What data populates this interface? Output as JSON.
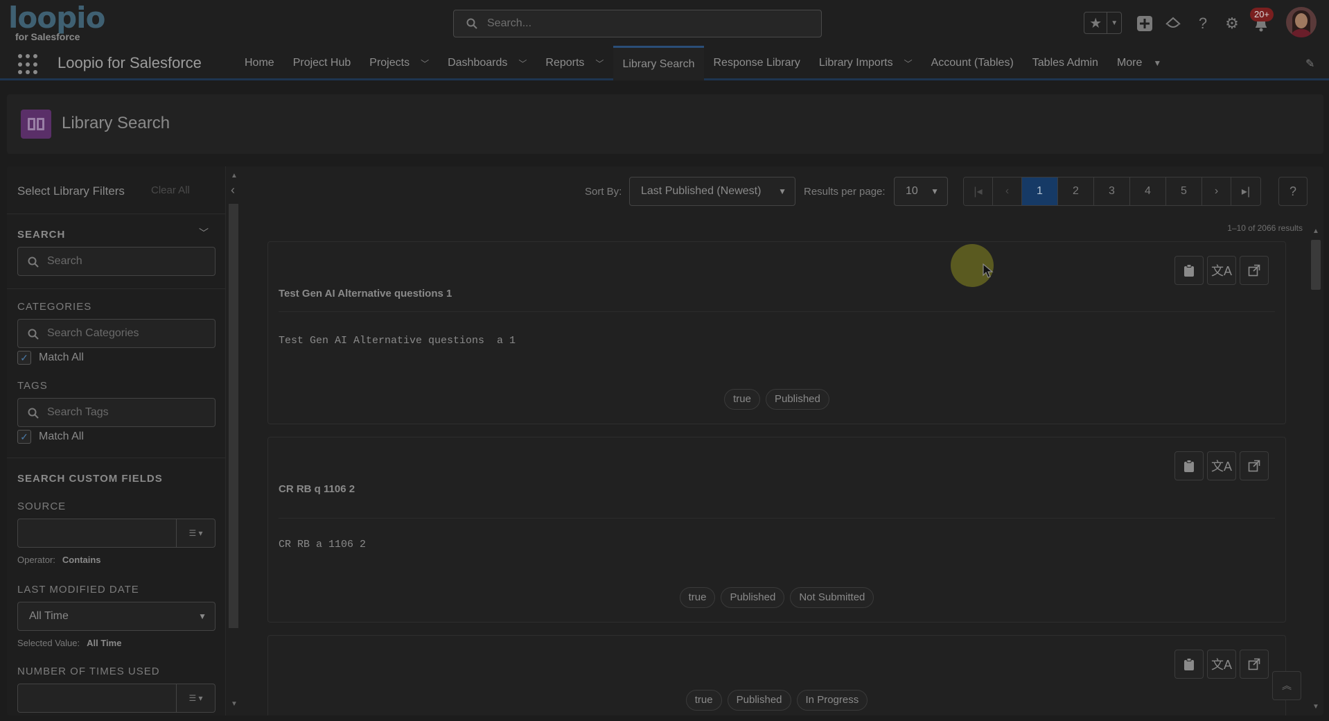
{
  "brand": {
    "logo_text": "loopio",
    "logo_sub": "for Salesforce"
  },
  "global_header": {
    "search_placeholder": "Search...",
    "notification_badge": "20+"
  },
  "app_nav": {
    "app_name": "Loopio for Salesforce",
    "items": [
      {
        "label": "Home",
        "has_menu": false
      },
      {
        "label": "Project Hub",
        "has_menu": false
      },
      {
        "label": "Projects",
        "has_menu": true
      },
      {
        "label": "Dashboards",
        "has_menu": true
      },
      {
        "label": "Reports",
        "has_menu": true
      },
      {
        "label": "Library Search",
        "has_menu": false,
        "active": true
      },
      {
        "label": "Response Library",
        "has_menu": false
      },
      {
        "label": "Library Imports",
        "has_menu": true
      },
      {
        "label": "Account (Tables)",
        "has_menu": false
      },
      {
        "label": "Tables Admin",
        "has_menu": false
      },
      {
        "label": "More",
        "has_menu": true
      }
    ]
  },
  "page_header": {
    "title": "Library Search"
  },
  "filters": {
    "title": "Select Library Filters",
    "clear_all": "Clear All",
    "search": {
      "label": "SEARCH",
      "placeholder": "Search"
    },
    "categories": {
      "label": "CATEGORIES",
      "placeholder": "Search Categories",
      "match_all_label": "Match All",
      "match_all": true
    },
    "tags": {
      "label": "TAGS",
      "placeholder": "Search Tags",
      "match_all_label": "Match All",
      "match_all": true
    },
    "custom_fields": {
      "label": "SEARCH CUSTOM FIELDS",
      "source": {
        "label": "SOURCE",
        "value": "",
        "operator_label": "Operator:",
        "operator_value": "Contains"
      },
      "last_modified": {
        "label": "LAST MODIFIED DATE",
        "value": "All Time",
        "selected_label": "Selected Value:",
        "selected_value": "All Time"
      },
      "times_used": {
        "label": "NUMBER OF TIMES USED",
        "value": ""
      }
    }
  },
  "toolbar": {
    "sort_label": "Sort By:",
    "sort_value": "Last Published (Newest)",
    "per_page_label": "Results per page:",
    "per_page_value": "10",
    "pages": [
      "1",
      "2",
      "3",
      "4",
      "5"
    ],
    "current_page": "1",
    "help": "?"
  },
  "results_count": "1–10 of 2066 results",
  "results": [
    {
      "question": "Test Gen AI Alternative questions 1",
      "answer": "Test Gen AI Alternative questions  a 1",
      "tags": [
        "true",
        "Published"
      ]
    },
    {
      "question": "CR RB q 1106 2",
      "answer": "CR RB a 1106 2",
      "tags": [
        "true",
        "Published",
        "Not Submitted"
      ]
    },
    {
      "question": "",
      "answer": "",
      "tags": [
        "true",
        "Published",
        "In Progress"
      ]
    }
  ],
  "colors": {
    "accent": "#163a66",
    "page_icon": "#5a2f68",
    "badge": "#7a1f1f"
  }
}
